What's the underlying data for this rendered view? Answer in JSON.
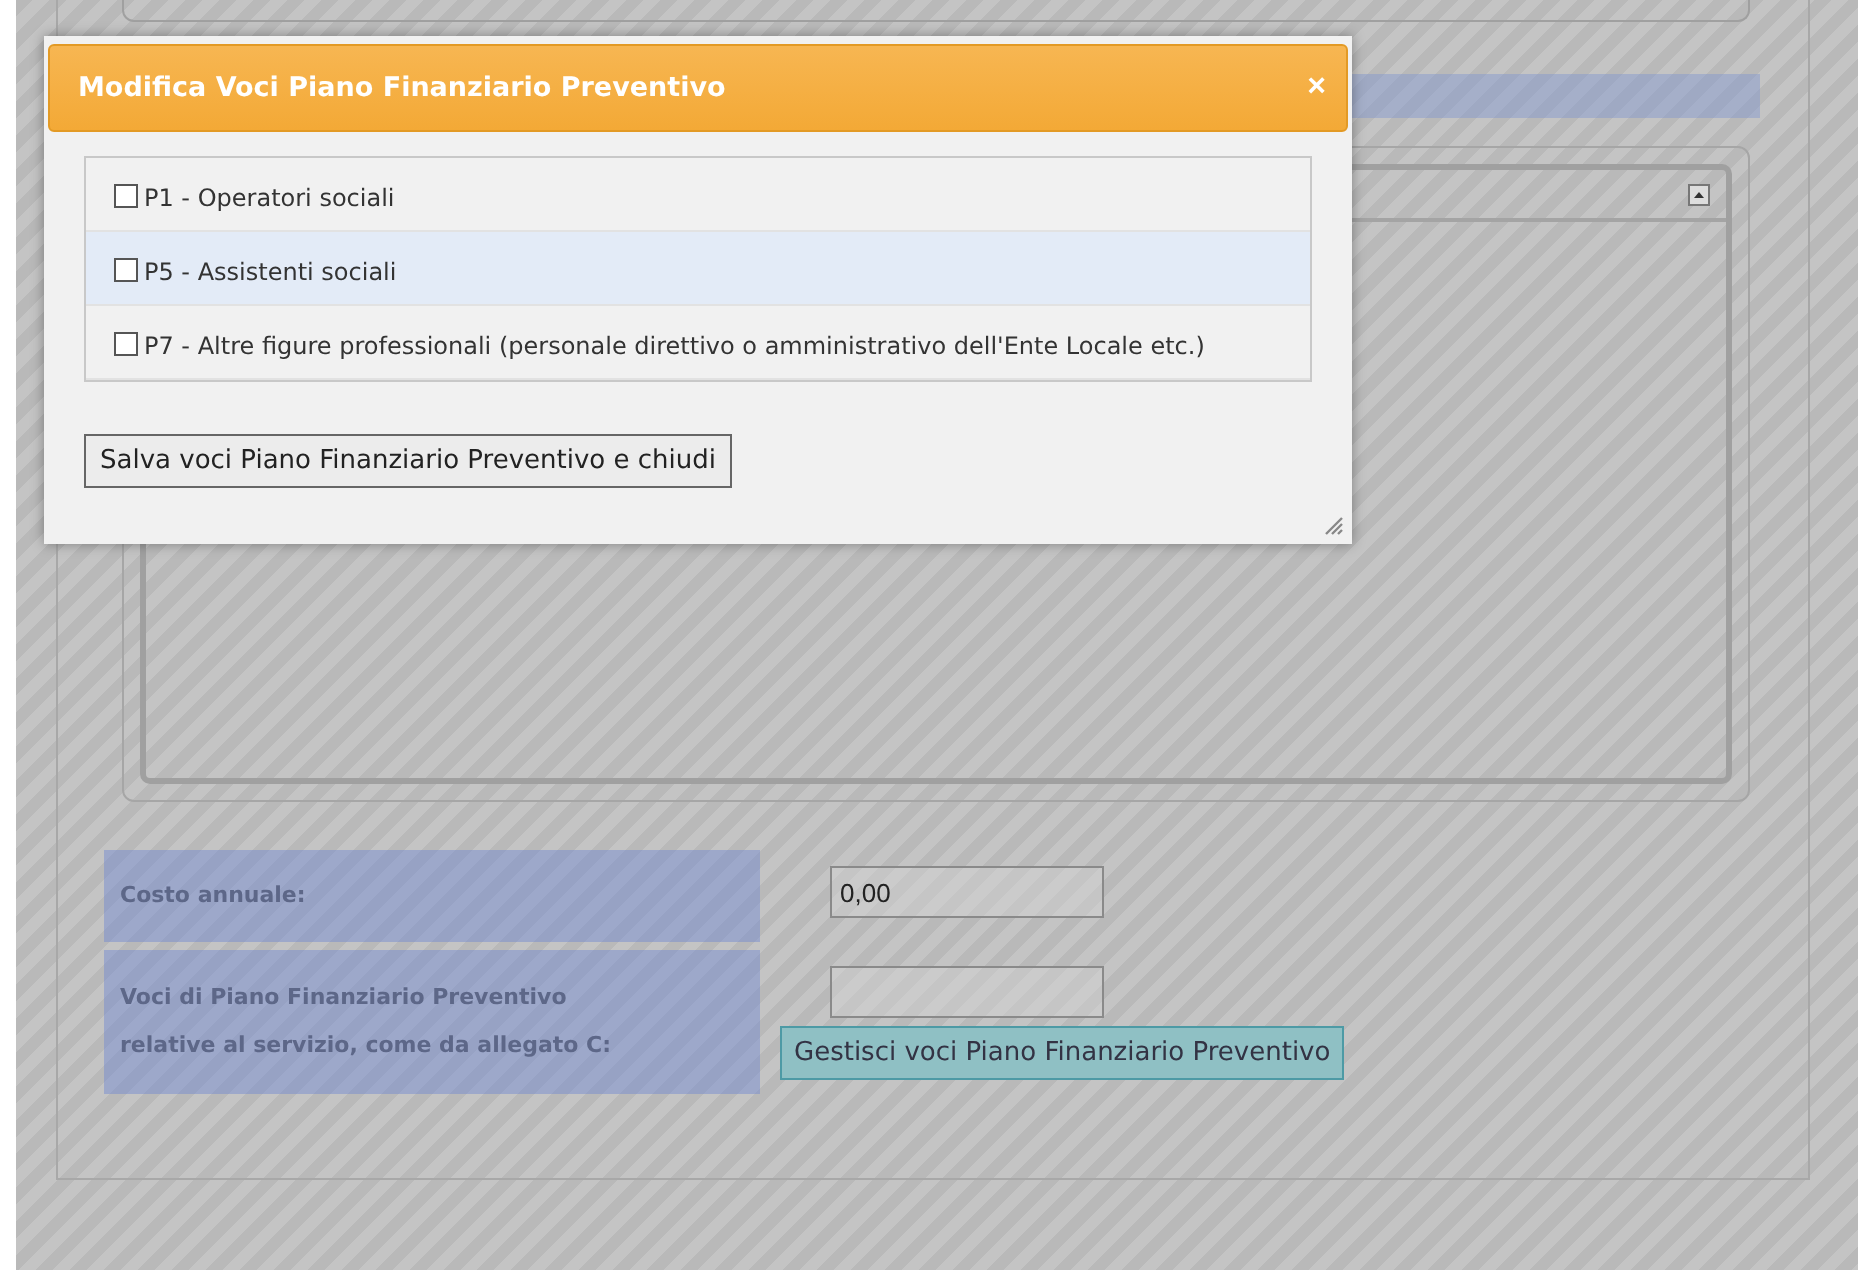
{
  "dialog": {
    "title": "Modifica Voci Piano Finanziario Preventivo",
    "close": "×",
    "items": [
      {
        "label": "P1 - Operatori sociali",
        "checked": false,
        "selected": false
      },
      {
        "label": "P5 - Assistenti sociali",
        "checked": false,
        "selected": true
      },
      {
        "label": "P7 - Altre figure professionali (personale direttivo o amministrativo dell'Ente Locale etc.)",
        "checked": false,
        "selected": false
      }
    ],
    "save_button": "Salva voci Piano Finanziario Preventivo e chiudi"
  },
  "form": {
    "fields": [
      {
        "label": "Costo annuale:",
        "value": "0,00"
      },
      {
        "label": "Voci di Piano Finanziario Preventivo relative al servizio, come da allegato C:",
        "button": "Gestisci voci Piano Finanziario Preventivo"
      }
    ]
  }
}
